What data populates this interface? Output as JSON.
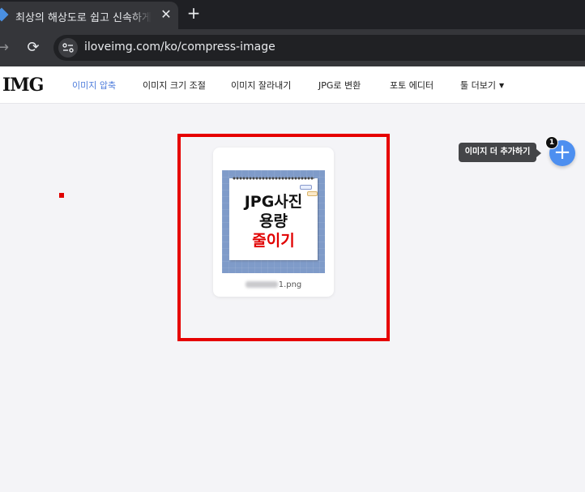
{
  "browser": {
    "tab_title": "최상의 해상도로 쉽고 신속하게",
    "tab_close": "✕",
    "new_tab": "+",
    "forward": "→",
    "reload": "⟳",
    "url": "iloveimg.com/ko/compress-image"
  },
  "site": {
    "logo": "IMG",
    "nav": [
      {
        "label": "이미지 압축",
        "active": true
      },
      {
        "label": "이미지 크기 조절"
      },
      {
        "label": "이미지 잘라내기"
      },
      {
        "label": "JPG로 변환"
      },
      {
        "label": "포토 에디터"
      },
      {
        "label": "툴 더보기"
      }
    ],
    "dropdown_caret": "▼"
  },
  "upload": {
    "file": {
      "name_visible": "1.png",
      "thumbnail_lines": [
        "JPG사진",
        "용량",
        "줄이기"
      ]
    },
    "add_more_tooltip": "이미지 더 추가하기",
    "add_button": "+",
    "file_count": "1"
  },
  "colors": {
    "accent": "#4d8ff0",
    "active_nav": "#4d7cdb",
    "highlight": "#e60000"
  }
}
